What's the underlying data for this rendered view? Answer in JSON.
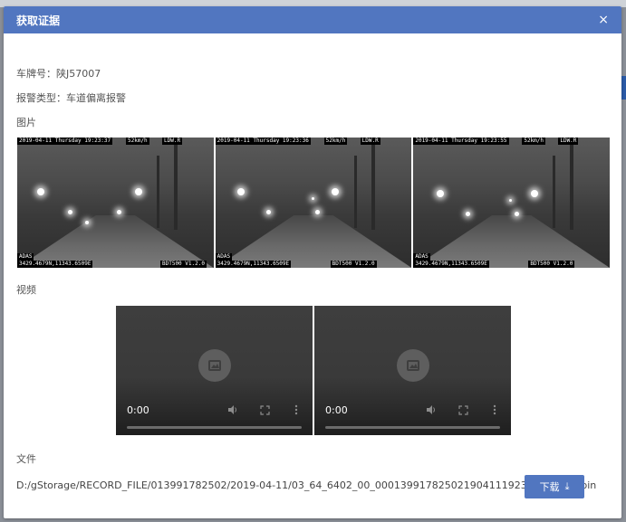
{
  "dialog": {
    "title": "获取证据",
    "close_glyph": "×"
  },
  "fields": {
    "plate_label": "车牌号：",
    "plate_value": "陕J57007",
    "alarm_label": "报警类型：",
    "alarm_value": "车道偏离报警"
  },
  "sections": {
    "images": "图片",
    "videos": "视频",
    "files": "文件"
  },
  "images": [
    {
      "timestamp": "2019-04-11 Thursday 19:23:37",
      "speed": "52km/h",
      "tag": "LDW.R",
      "mode": "ADAS",
      "coords": "3429.4679N,11343.6509E",
      "device": "BDT500 V1.2.0"
    },
    {
      "timestamp": "2019-04-11 Thursday 19:23:36",
      "speed": "52km/h",
      "tag": "LDW.R",
      "mode": "ADAS",
      "coords": "3429.4679N,11343.6509E",
      "device": "BDT500 V1.2.0"
    },
    {
      "timestamp": "2019-04-11 Thursday 19:23:55",
      "speed": "52km/h",
      "tag": "LDW.R",
      "mode": "ADAS",
      "coords": "3429.4679N,11343.6509E",
      "device": "BDT500 V1.2.0"
    }
  ],
  "videos": [
    {
      "time": "0:00"
    },
    {
      "time": "0:00"
    }
  ],
  "file": {
    "path": "D:/gStorage/RECORD_FILE/013991782502/2019-04-11/03_64_6402_00_00013991782502190411192355000600.bin",
    "download_label": "下载",
    "download_icon": "⤓"
  },
  "colors": {
    "header_bg": "#5176c0",
    "button_bg": "#5176c0"
  }
}
